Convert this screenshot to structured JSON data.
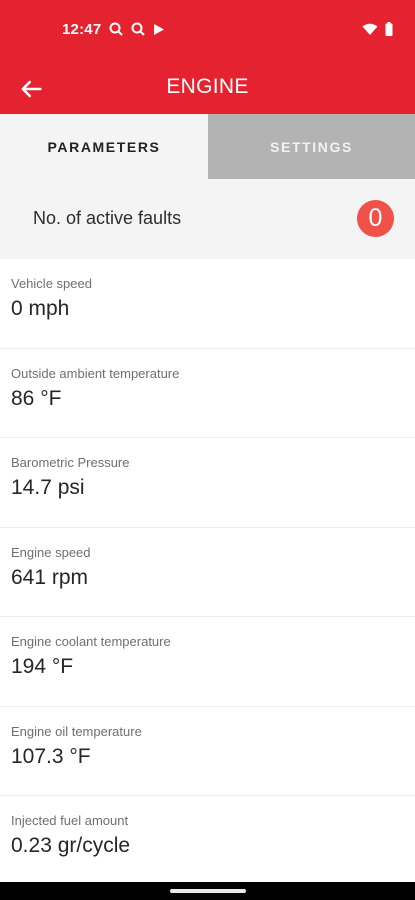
{
  "status_bar": {
    "time": "12:47",
    "left_icons": [
      "notification-icon",
      "notification-icon",
      "play-store-icon"
    ],
    "right_icons": [
      "wifi-icon",
      "battery-icon"
    ]
  },
  "app_bar": {
    "title": "ENGINE",
    "back_icon": "arrow-back-icon"
  },
  "tabs": [
    {
      "label": "PARAMETERS",
      "active": true
    },
    {
      "label": "SETTINGS",
      "active": false
    }
  ],
  "faults": {
    "label": "No. of active faults",
    "count": "0"
  },
  "parameters": [
    {
      "label": "Vehicle speed",
      "value": "0 mph"
    },
    {
      "label": "Outside ambient temperature",
      "value": "86 °F"
    },
    {
      "label": "Barometric Pressure",
      "value": "14.7 psi"
    },
    {
      "label": "Engine speed",
      "value": "641 rpm"
    },
    {
      "label": "Engine coolant temperature",
      "value": "194 °F"
    },
    {
      "label": "Engine oil temperature",
      "value": "107.3 °F"
    },
    {
      "label": "Injected fuel amount",
      "value": "0.23 gr/cycle"
    }
  ],
  "colors": {
    "brand": "#e42230",
    "badge": "#f05249",
    "inactive_tab": "#b3b3b3"
  }
}
